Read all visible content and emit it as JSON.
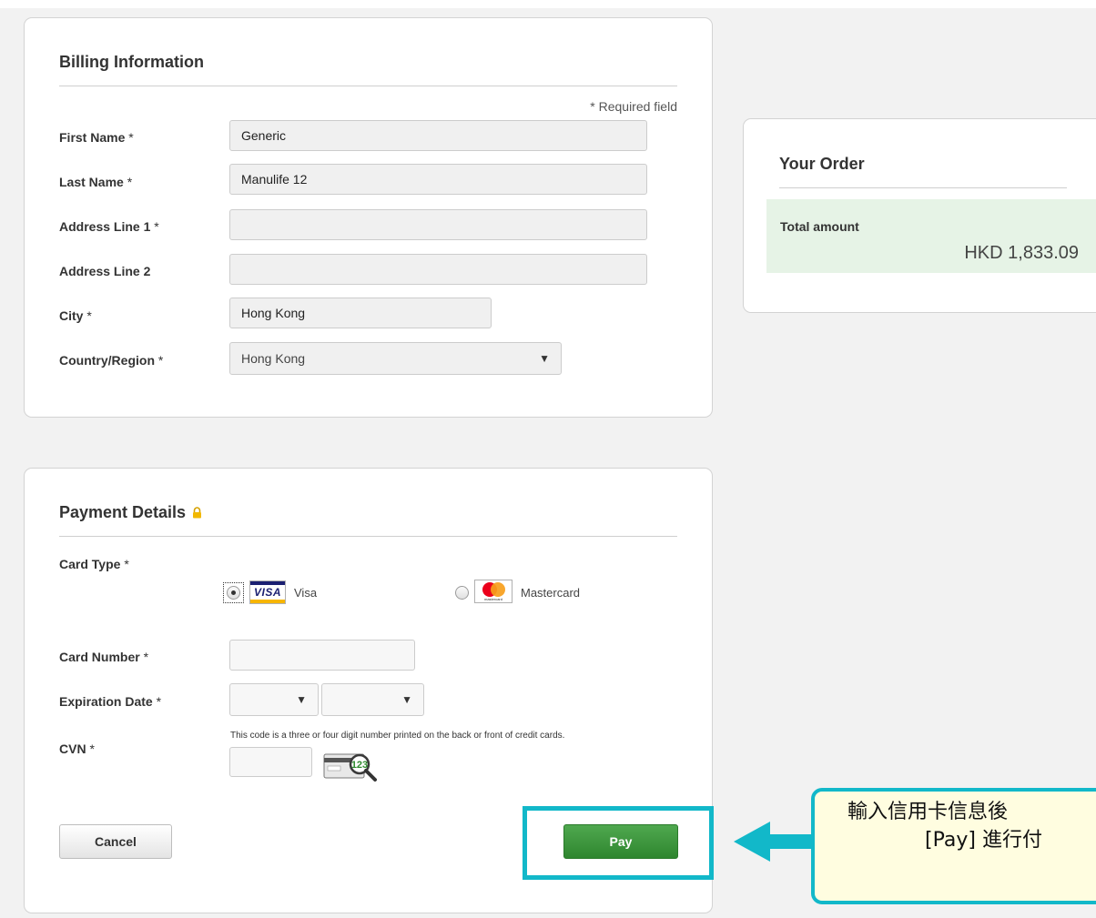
{
  "billing": {
    "title": "Billing Information",
    "required_note": "* Required field",
    "fields": {
      "first_name": {
        "label": "First Name",
        "value": "Generic"
      },
      "last_name": {
        "label": "Last Name",
        "value": "Manulife 12"
      },
      "address1": {
        "label": "Address Line 1",
        "value": ""
      },
      "address2": {
        "label": "Address Line 2",
        "value": ""
      },
      "city": {
        "label": "City",
        "value": "Hong Kong"
      },
      "country": {
        "label": "Country/Region",
        "value": "Hong Kong"
      }
    },
    "req_mark": "*"
  },
  "payment": {
    "title": "Payment Details",
    "card_type_label": "Card Type",
    "visa_label": "Visa",
    "visa_logo_text": "VISA",
    "mastercard_label": "Mastercard",
    "card_number_label": "Card Number",
    "card_number_value": "",
    "expiration_label": "Expiration Date",
    "expiration_month": "",
    "expiration_year": "",
    "cvn_label": "CVN",
    "cvn_hint": "This code is a three or four digit number printed on the back or front of credit cards.",
    "cvn_value": "",
    "cvn_icon_text": "123",
    "cancel_label": "Cancel",
    "pay_label": "Pay",
    "selected_card": "visa"
  },
  "order": {
    "title": "Your Order",
    "total_label": "Total amount",
    "total_value": "HKD 1,833.09"
  },
  "annotation": {
    "line1": "輸入信用卡信息後",
    "line2": "[Pay] 進行付"
  },
  "colors": {
    "accent": "#12b8c9",
    "pay_green": "#3a963a",
    "order_bg": "#e6f3e6"
  }
}
